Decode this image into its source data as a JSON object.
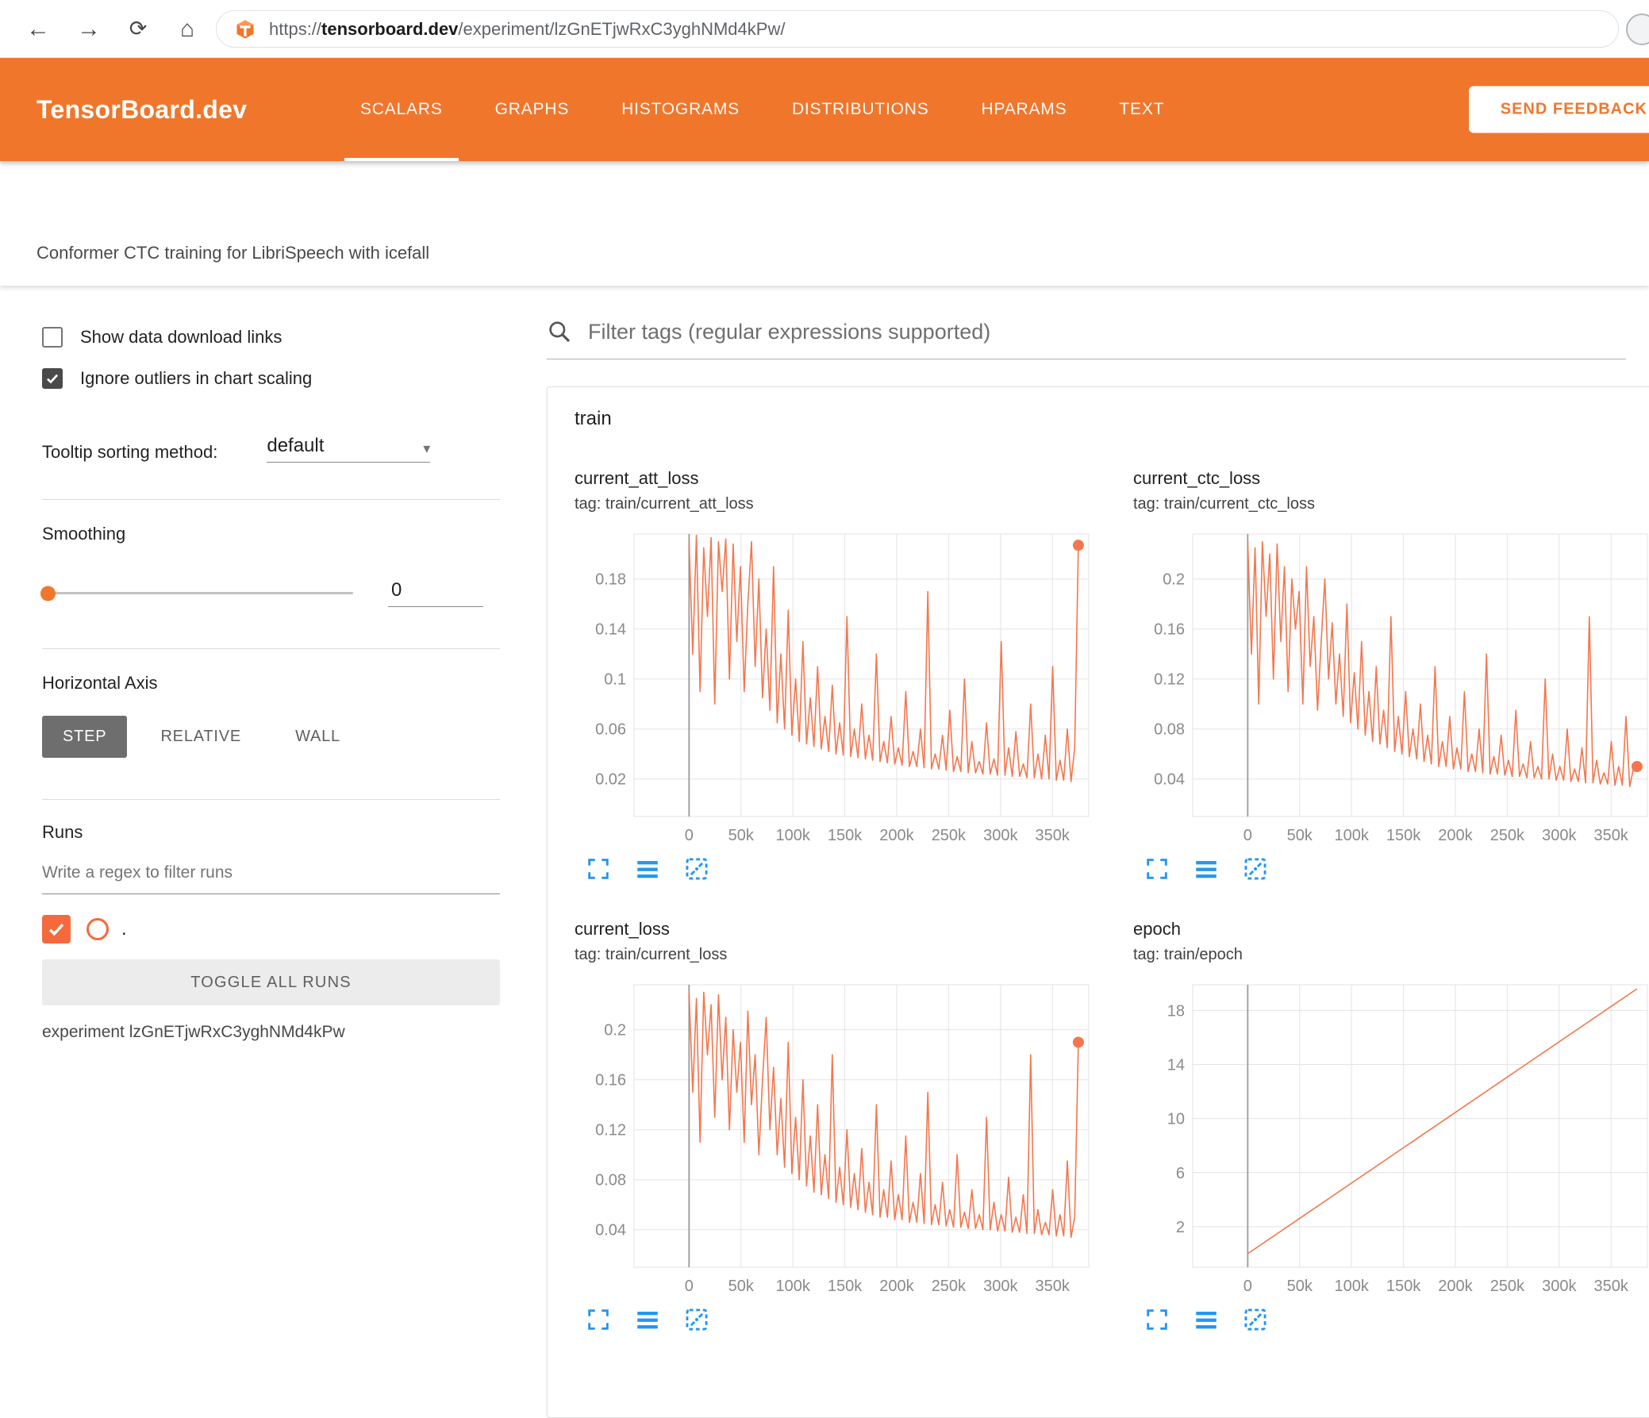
{
  "browser": {
    "url_scheme": "https://",
    "url_domain": "tensorboard.dev",
    "url_path": "/experiment/lzGnETjwRxC3yghNMd4kPw/"
  },
  "icons": {
    "back": "←",
    "forward": "→",
    "reload": "⟳",
    "home": "⌂",
    "caret": "▾"
  },
  "header": {
    "brand": "TensorBoard.dev",
    "tabs": [
      {
        "label": "SCALARS",
        "active": true
      },
      {
        "label": "GRAPHS",
        "active": false
      },
      {
        "label": "HISTOGRAMS",
        "active": false
      },
      {
        "label": "DISTRIBUTIONS",
        "active": false
      },
      {
        "label": "HPARAMS",
        "active": false
      },
      {
        "label": "TEXT",
        "active": false
      }
    ],
    "feedback_label": "SEND FEEDBACK"
  },
  "subtitle": {
    "text": "Conformer CTC training for LibriSpeech with icefall"
  },
  "sidebar": {
    "show_download": {
      "label": "Show data download links",
      "checked": false
    },
    "ignore_outliers": {
      "label": "Ignore outliers in chart scaling",
      "checked": true
    },
    "tooltip_sorting": {
      "label": "Tooltip sorting method:",
      "value": "default"
    },
    "smoothing": {
      "label": "Smoothing",
      "value": "0"
    },
    "horizontal_axis": {
      "label": "Horizontal Axis",
      "options": [
        "STEP",
        "RELATIVE",
        "WALL"
      ],
      "selected": "STEP"
    },
    "runs": {
      "label": "Runs",
      "filter_placeholder": "Write a regex to filter runs",
      "run_label": ".",
      "run_checked": true,
      "toggle_button": "TOGGLE ALL RUNS",
      "experiment": "experiment lzGnETjwRxC3yghNMd4kPw"
    }
  },
  "main": {
    "filter_placeholder": "Filter tags (regular expressions supported)",
    "card_title": "train"
  },
  "colors": {
    "header_orange": "#f0762c",
    "run_color": "#f4764e",
    "toolbar_blue": "#2196f3",
    "tick_gray": "#8a8a8a"
  },
  "chart_data": [
    {
      "type": "line",
      "title": "current_att_loss",
      "subtitle": "tag: train/current_att_loss",
      "color": "#f4764e",
      "xlim": [
        -53000,
        385000
      ],
      "ylim": [
        -0.01,
        0.216
      ],
      "xticks": [
        0,
        50000,
        100000,
        150000,
        200000,
        250000,
        300000,
        350000
      ],
      "xtick_labels": [
        "0",
        "50k",
        "100k",
        "150k",
        "200k",
        "250k",
        "300k",
        "350k"
      ],
      "yticks": [
        0.02,
        0.06,
        0.1,
        0.14,
        0.18
      ],
      "ytick_labels": [
        "0.02",
        "0.06",
        "0.1",
        "0.14",
        "0.18"
      ],
      "x_start": 0,
      "x_end": 375000,
      "values": [
        0.21,
        0.12,
        0.215,
        0.09,
        0.205,
        0.15,
        0.213,
        0.08,
        0.21,
        0.17,
        0.212,
        0.1,
        0.208,
        0.13,
        0.19,
        0.09,
        0.16,
        0.21,
        0.11,
        0.18,
        0.085,
        0.14,
        0.075,
        0.19,
        0.065,
        0.12,
        0.06,
        0.155,
        0.055,
        0.1,
        0.05,
        0.13,
        0.048,
        0.085,
        0.046,
        0.11,
        0.044,
        0.07,
        0.042,
        0.095,
        0.04,
        0.065,
        0.039,
        0.15,
        0.038,
        0.06,
        0.037,
        0.08,
        0.036,
        0.055,
        0.035,
        0.12,
        0.034,
        0.05,
        0.033,
        0.07,
        0.032,
        0.045,
        0.031,
        0.09,
        0.03,
        0.042,
        0.03,
        0.06,
        0.029,
        0.17,
        0.028,
        0.04,
        0.028,
        0.055,
        0.027,
        0.075,
        0.026,
        0.038,
        0.026,
        0.1,
        0.025,
        0.05,
        0.025,
        0.034,
        0.024,
        0.065,
        0.024,
        0.036,
        0.023,
        0.13,
        0.023,
        0.045,
        0.022,
        0.058,
        0.022,
        0.032,
        0.021,
        0.08,
        0.021,
        0.04,
        0.02,
        0.055,
        0.02,
        0.11,
        0.019,
        0.035,
        0.019,
        0.06,
        0.018,
        0.045,
        0.207
      ],
      "end_dot": [
        375000,
        0.207
      ]
    },
    {
      "type": "line",
      "title": "current_ctc_loss",
      "subtitle": "tag: train/current_ctc_loss",
      "color": "#f4764e",
      "xlim": [
        -53000,
        385000
      ],
      "ylim": [
        0.01,
        0.236
      ],
      "xticks": [
        0,
        50000,
        100000,
        150000,
        200000,
        250000,
        300000,
        350000
      ],
      "xtick_labels": [
        "0",
        "50k",
        "100k",
        "150k",
        "200k",
        "250k",
        "300k",
        "350k"
      ],
      "yticks": [
        0.04,
        0.08,
        0.12,
        0.16,
        0.2
      ],
      "ytick_labels": [
        "0.04",
        "0.08",
        "0.12",
        "0.16",
        "0.2"
      ],
      "x_start": 0,
      "x_end": 375000,
      "values": [
        0.23,
        0.14,
        0.225,
        0.1,
        0.23,
        0.17,
        0.22,
        0.12,
        0.228,
        0.15,
        0.21,
        0.11,
        0.2,
        0.16,
        0.19,
        0.1,
        0.21,
        0.13,
        0.17,
        0.095,
        0.15,
        0.2,
        0.12,
        0.165,
        0.1,
        0.14,
        0.09,
        0.18,
        0.085,
        0.125,
        0.08,
        0.15,
        0.075,
        0.11,
        0.07,
        0.13,
        0.068,
        0.095,
        0.065,
        0.17,
        0.062,
        0.09,
        0.06,
        0.11,
        0.058,
        0.08,
        0.056,
        0.1,
        0.054,
        0.075,
        0.052,
        0.13,
        0.05,
        0.07,
        0.05,
        0.09,
        0.048,
        0.065,
        0.048,
        0.11,
        0.046,
        0.06,
        0.046,
        0.08,
        0.045,
        0.14,
        0.044,
        0.058,
        0.044,
        0.075,
        0.043,
        0.055,
        0.042,
        0.095,
        0.042,
        0.052,
        0.041,
        0.07,
        0.041,
        0.05,
        0.04,
        0.12,
        0.04,
        0.06,
        0.039,
        0.05,
        0.039,
        0.08,
        0.038,
        0.048,
        0.038,
        0.065,
        0.037,
        0.17,
        0.037,
        0.055,
        0.036,
        0.045,
        0.036,
        0.07,
        0.035,
        0.05,
        0.035,
        0.09,
        0.034,
        0.048,
        0.05
      ],
      "end_dot": [
        375000,
        0.05
      ]
    },
    {
      "type": "line",
      "title": "current_loss",
      "subtitle": "tag: train/current_loss",
      "color": "#f4764e",
      "xlim": [
        -53000,
        385000
      ],
      "ylim": [
        0.01,
        0.236
      ],
      "xticks": [
        0,
        50000,
        100000,
        150000,
        200000,
        250000,
        300000,
        350000
      ],
      "xtick_labels": [
        "0",
        "50k",
        "100k",
        "150k",
        "200k",
        "250k",
        "300k",
        "350k"
      ],
      "yticks": [
        0.04,
        0.08,
        0.12,
        0.16,
        0.2
      ],
      "ytick_labels": [
        "0.04",
        "0.08",
        "0.12",
        "0.16",
        "0.2"
      ],
      "x_start": 0,
      "x_end": 375000,
      "values": [
        0.23,
        0.15,
        0.225,
        0.11,
        0.23,
        0.18,
        0.22,
        0.13,
        0.228,
        0.16,
        0.21,
        0.12,
        0.2,
        0.15,
        0.19,
        0.11,
        0.215,
        0.14,
        0.18,
        0.1,
        0.16,
        0.21,
        0.12,
        0.17,
        0.1,
        0.145,
        0.09,
        0.19,
        0.085,
        0.13,
        0.08,
        0.16,
        0.075,
        0.115,
        0.07,
        0.14,
        0.068,
        0.1,
        0.065,
        0.18,
        0.062,
        0.09,
        0.06,
        0.12,
        0.058,
        0.085,
        0.056,
        0.105,
        0.054,
        0.078,
        0.052,
        0.14,
        0.05,
        0.072,
        0.05,
        0.095,
        0.048,
        0.068,
        0.048,
        0.115,
        0.046,
        0.062,
        0.046,
        0.085,
        0.045,
        0.15,
        0.044,
        0.06,
        0.044,
        0.078,
        0.043,
        0.056,
        0.042,
        0.1,
        0.042,
        0.054,
        0.041,
        0.072,
        0.041,
        0.052,
        0.04,
        0.13,
        0.04,
        0.062,
        0.039,
        0.052,
        0.039,
        0.082,
        0.038,
        0.05,
        0.038,
        0.068,
        0.037,
        0.18,
        0.037,
        0.056,
        0.036,
        0.046,
        0.036,
        0.072,
        0.035,
        0.052,
        0.035,
        0.095,
        0.034,
        0.05,
        0.19
      ],
      "end_dot": [
        375000,
        0.19
      ]
    },
    {
      "type": "line",
      "title": "epoch",
      "subtitle": "tag: train/epoch",
      "color": "#f4764e",
      "xlim": [
        -53000,
        385000
      ],
      "ylim": [
        -1,
        19.9
      ],
      "xticks": [
        0,
        50000,
        100000,
        150000,
        200000,
        250000,
        300000,
        350000
      ],
      "xtick_labels": [
        "0",
        "50k",
        "100k",
        "150k",
        "200k",
        "250k",
        "300k",
        "350k"
      ],
      "yticks": [
        2,
        6,
        10,
        14,
        18
      ],
      "ytick_labels": [
        "2",
        "6",
        "10",
        "14",
        "18"
      ],
      "x_start": 0,
      "x_end": 375000,
      "values": [
        0,
        19.6
      ]
    }
  ]
}
